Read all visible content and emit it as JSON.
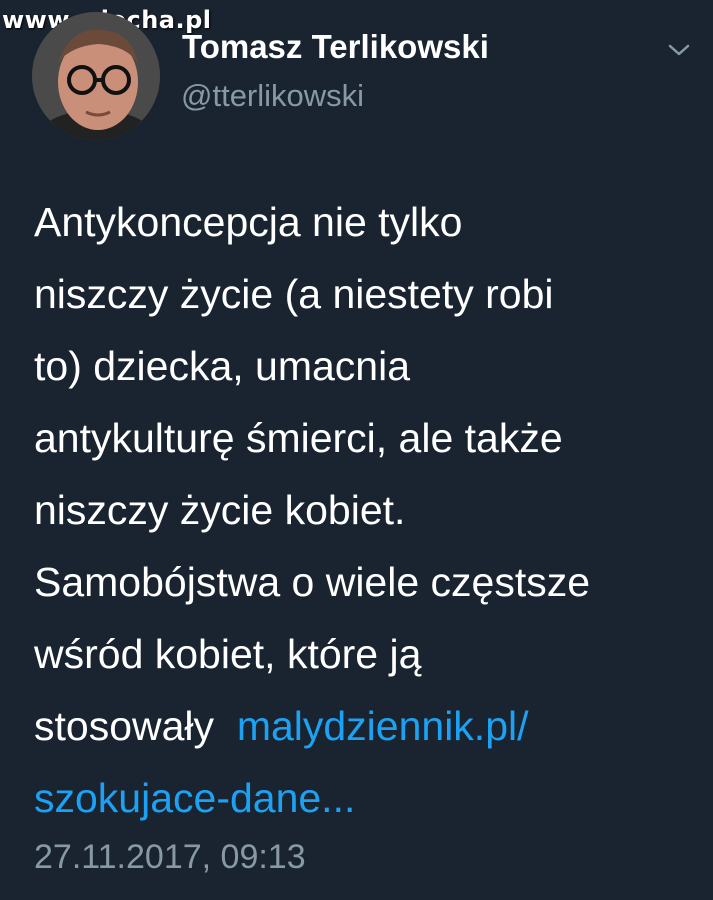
{
  "watermark": "www.wiocha.pl",
  "user": {
    "name": "Tomasz Terlikowski",
    "handle": "@tterlikowski"
  },
  "icons": {
    "avatar": "avatar-photo",
    "menu": "chevron-down-icon"
  },
  "tweet": {
    "lines": [
      "Antykoncepcja nie tylko",
      "niszczy życie (a niestety robi",
      "to) dziecka, umacnia",
      "antykulturę śmierci, ale także",
      "niszczy życie kobiet.",
      "Samobójstwa o wiele częstsze",
      "wśród kobiet, które ją",
      "stosowały"
    ],
    "link_part1": "malydziennik.pl/",
    "link_part2": "szokujace-dane..."
  },
  "timestamp": "27.11.2017, 09:13",
  "colors": {
    "background": "#1a2430",
    "text": "#ffffff",
    "secondary": "#8899a6",
    "link": "#1da1f2"
  }
}
